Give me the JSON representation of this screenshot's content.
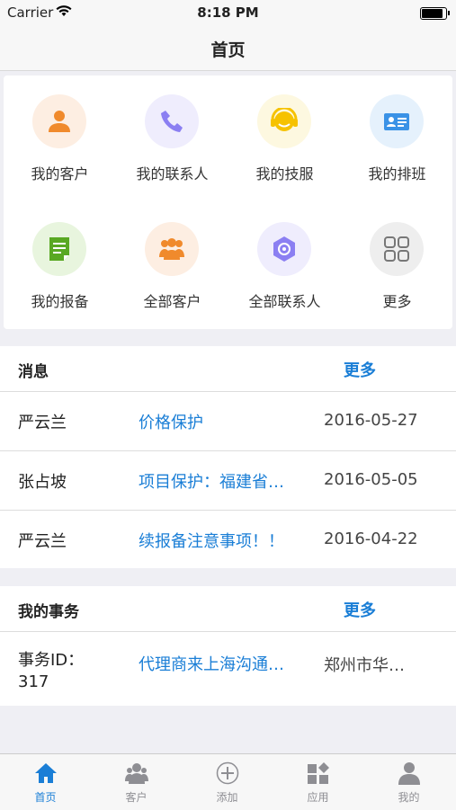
{
  "status_bar": {
    "carrier": "Carrier",
    "time": "8:18 PM",
    "battery_level": 0.95
  },
  "nav": {
    "title": "首页"
  },
  "grid": [
    {
      "label": "我的客户",
      "icon": "person-icon",
      "color": "#f08a2c",
      "bg": "#fdeee2"
    },
    {
      "label": "我的联系人",
      "icon": "phone-icon",
      "color": "#8b7ff2",
      "bg": "#efedfd"
    },
    {
      "label": "我的技服",
      "icon": "headset-icon",
      "color": "#f6c200",
      "bg": "#fdf8e0"
    },
    {
      "label": "我的排班",
      "icon": "id-card-icon",
      "color": "#3a92e6",
      "bg": "#e5f1fc"
    },
    {
      "label": "我的报备",
      "icon": "document-icon",
      "color": "#59a823",
      "bg": "#e8f5de"
    },
    {
      "label": "全部客户",
      "icon": "group-icon",
      "color": "#f08a2c",
      "bg": "#fdeee2"
    },
    {
      "label": "全部联系人",
      "icon": "contacts-icon",
      "color": "#8b7ff2",
      "bg": "#efedfd"
    },
    {
      "label": "更多",
      "icon": "grid-icon",
      "color": "#777777",
      "bg": "#eeeeee"
    }
  ],
  "messages": {
    "title": "消息",
    "more": "更多",
    "rows": [
      {
        "name": "严云兰",
        "subject": "价格保护",
        "date": "2016-05-27"
      },
      {
        "name": "张占坡",
        "subject": "项目保护：福建省…",
        "date": "2016-05-05"
      },
      {
        "name": "严云兰",
        "subject": "续报备注意事项！！",
        "date": "2016-04-22"
      }
    ]
  },
  "tasks": {
    "title": "我的事务",
    "more": "更多",
    "rows": [
      {
        "id_label": "事务ID：",
        "id_value": "317",
        "subject": "代理商来上海沟通…",
        "location": "郑州市华…"
      }
    ]
  },
  "tabs": [
    {
      "label": "首页",
      "icon": "home-icon"
    },
    {
      "label": "客户",
      "icon": "customers-icon"
    },
    {
      "label": "添加",
      "icon": "add-icon"
    },
    {
      "label": "应用",
      "icon": "apps-icon"
    },
    {
      "label": "我的",
      "icon": "profile-icon"
    }
  ],
  "colors": {
    "accent": "#1a7ed6",
    "background": "#efeff4"
  }
}
